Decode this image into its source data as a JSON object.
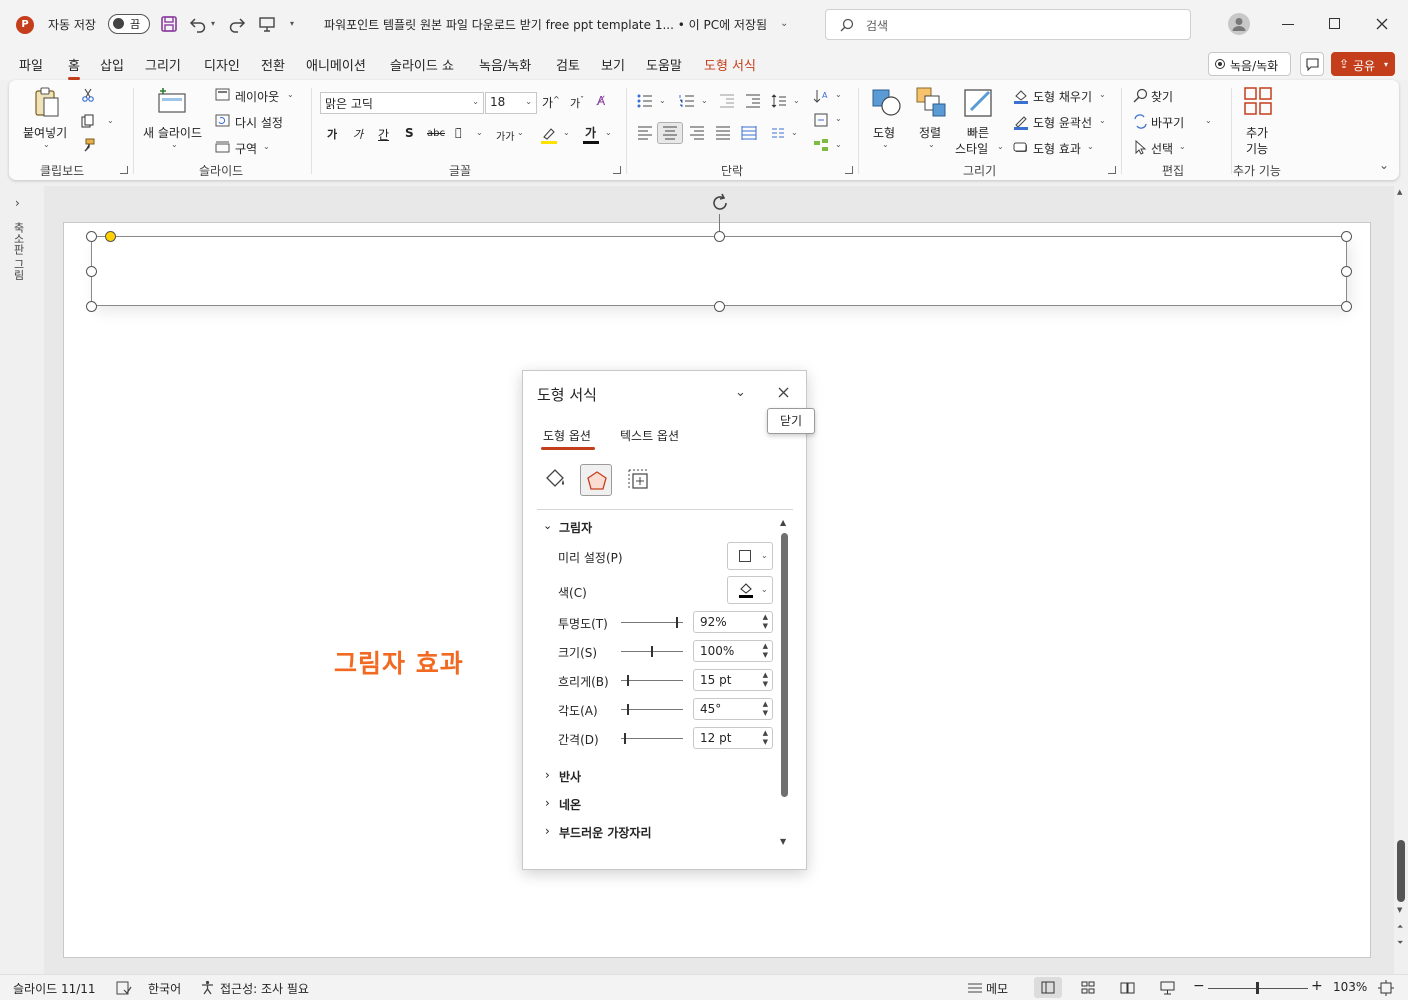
{
  "colors": {
    "accent": "#c43e1c",
    "ppt_logo": "#c43e1c",
    "shadow_text": "#f26a21",
    "handle_yellow": "#ffd100"
  },
  "titlebar": {
    "autosave_label": "자동 저장",
    "autosave_state": "끔",
    "doc_title": "파워포인트 템플릿 원본 파일 다운로드 받기 free ppt template 1... • 이 PC에 저장됨",
    "search_placeholder": "검색"
  },
  "menu": {
    "tabs": [
      "파일",
      "홈",
      "삽입",
      "그리기",
      "디자인",
      "전환",
      "애니메이션",
      "슬라이드 쇼",
      "녹음/녹화",
      "검토",
      "보기",
      "도움말",
      "도형 서식"
    ],
    "active": "홈",
    "record_button": "녹음/녹화",
    "share_button": "공유"
  },
  "ribbon": {
    "clipboard": {
      "paste": "붙여넣기",
      "group": "클립보드"
    },
    "slides": {
      "new_slide": "새 슬라이드",
      "layout": "레이아웃",
      "reset": "다시 설정",
      "section": "구역",
      "group": "슬라이드"
    },
    "font": {
      "font_name": "맑은 고딕",
      "font_size": "18",
      "group": "글꼴",
      "bold": "가",
      "italic": "가",
      "underline": "간",
      "strike": "S",
      "highlight": "가"
    },
    "paragraph": {
      "group": "단락"
    },
    "drawing": {
      "shapes": "도형",
      "arrange": "정렬",
      "quick_styles_1": "빠른",
      "quick_styles_2": "스타일",
      "fill": "도형 채우기",
      "outline": "도형 윤곽선",
      "effects": "도형 효과",
      "group": "그리기"
    },
    "editing": {
      "find": "찾기",
      "replace": "바꾸기",
      "select": "선택",
      "group": "편집"
    },
    "addins": {
      "label_1": "추가",
      "label_2": "기능",
      "group": "추가 기능"
    }
  },
  "sidebar": {
    "label": "축소판 그림"
  },
  "slide": {
    "text": "그림자 효과"
  },
  "pane": {
    "title": "도형 서식",
    "tabs": [
      "도형 옵션",
      "텍스트 옵션"
    ],
    "active_tab": "도형 옵션",
    "tooltip": "닫기",
    "section_shadow": "그림자",
    "preset_label": "미리 설정(P)",
    "color_label": "색(C)",
    "rows": [
      {
        "label": "투명도(T)",
        "value": "92%",
        "level": 0.92
      },
      {
        "label": "크기(S)",
        "value": "100%",
        "level": 0.5
      },
      {
        "label": "흐리게(B)",
        "value": "15 pt",
        "level": 0.1
      },
      {
        "label": "각도(A)",
        "value": "45°",
        "level": 0.1
      },
      {
        "label": "간격(D)",
        "value": "12 pt",
        "level": 0.05
      }
    ],
    "sections": [
      "반사",
      "네온",
      "부드러운 가장자리"
    ]
  },
  "statusbar": {
    "slide_counter": "슬라이드 11/11",
    "language": "한국어",
    "accessibility": "접근성: 조사 필요",
    "notes": "메모",
    "zoom": "103%"
  }
}
